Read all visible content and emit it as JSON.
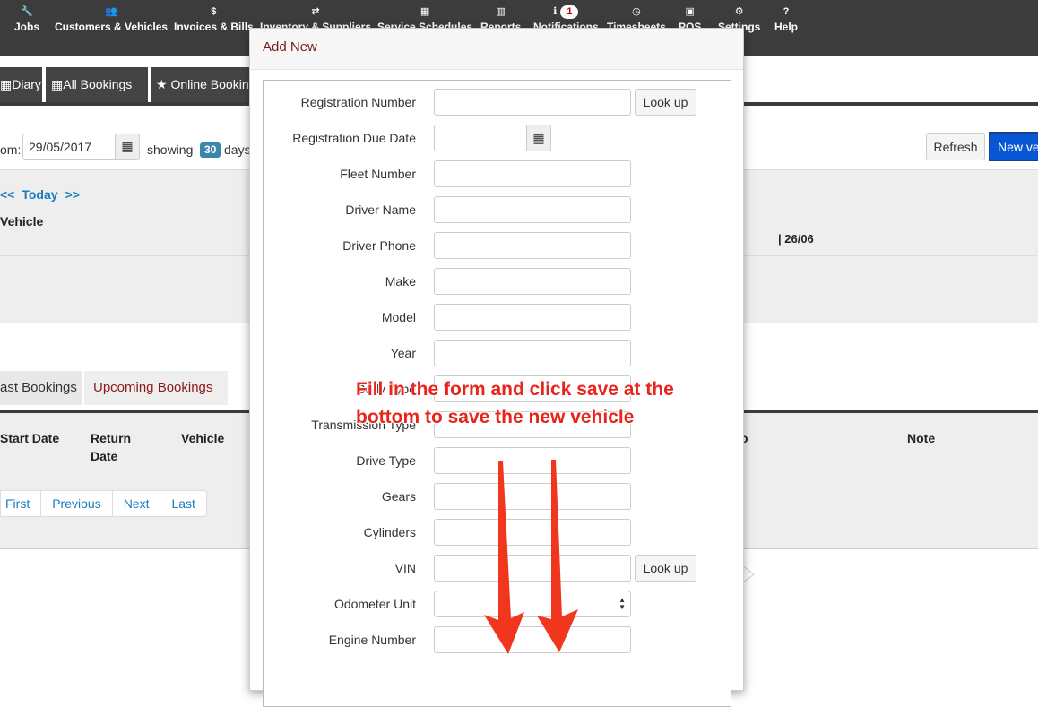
{
  "nav": {
    "items": [
      {
        "label": "Jobs",
        "icon": "wrench-icon",
        "glyph": "🔧"
      },
      {
        "label": "Customers & Vehicles",
        "icon": "users-icon",
        "glyph": "👥"
      },
      {
        "label": "Invoices & Bills",
        "icon": "dollar-icon",
        "glyph": "$"
      },
      {
        "label": "Inventory & Suppliers",
        "icon": "retweet-icon",
        "glyph": "⇄"
      },
      {
        "label": "Service Schedules",
        "icon": "calendar-icon",
        "glyph": "▦"
      },
      {
        "label": "Reports",
        "icon": "bar-chart-icon",
        "glyph": "▥"
      },
      {
        "label": "Notifications",
        "icon": "info-icon",
        "glyph": "ℹ",
        "badge": "1"
      },
      {
        "label": "Timesheets",
        "icon": "clock-icon",
        "glyph": "◷"
      },
      {
        "label": "POS",
        "icon": "money-icon",
        "glyph": "▣"
      },
      {
        "label": "Settings",
        "icon": "cogs-icon",
        "glyph": "⚙"
      },
      {
        "label": "Help",
        "icon": "question-icon",
        "glyph": "?"
      }
    ]
  },
  "subtabs": [
    {
      "label": "Diary",
      "icon": "calendar-icon",
      "glyph": "▦"
    },
    {
      "label": "All Bookings",
      "icon": "calendar-icon",
      "glyph": "▦"
    },
    {
      "label": "Online Bookings",
      "icon": "star-icon",
      "glyph": "★"
    }
  ],
  "filter": {
    "from_label": "om:",
    "date_value": "29/05/2017",
    "showing": "showing",
    "days_count": "30",
    "days_text": "days",
    "refresh": "Refresh",
    "new_vehicle": "New ve"
  },
  "diary": {
    "prev": "<<",
    "today": "Today",
    "next": ">>",
    "vehicle_header": "Vehicle",
    "date_column": "| 26/06"
  },
  "bookings": {
    "tabs": [
      "ast Bookings",
      "Upcoming Bookings"
    ],
    "columns": [
      "Start Date",
      "Return Date",
      "Vehicle",
      "o",
      "Note"
    ],
    "pager": [
      "First",
      "Previous",
      "Next",
      "Last"
    ]
  },
  "modal": {
    "title": "Add New",
    "lookup_label": "Look up",
    "fields": [
      {
        "label": "Registration Number",
        "type": "text",
        "value": ""
      },
      {
        "label": "Registration Due Date",
        "type": "date",
        "value": ""
      },
      {
        "label": "Fleet Number",
        "type": "text",
        "value": ""
      },
      {
        "label": "Driver Name",
        "type": "text",
        "value": ""
      },
      {
        "label": "Driver Phone",
        "type": "text",
        "value": ""
      },
      {
        "label": "Make",
        "type": "text",
        "value": ""
      },
      {
        "label": "Model",
        "type": "text",
        "value": ""
      },
      {
        "label": "Year",
        "type": "text",
        "value": ""
      },
      {
        "label": "Body Type",
        "type": "text",
        "value": ""
      },
      {
        "label": "Transmission Type",
        "type": "text",
        "value": ""
      },
      {
        "label": "Drive Type",
        "type": "text",
        "value": ""
      },
      {
        "label": "Gears",
        "type": "text",
        "value": ""
      },
      {
        "label": "Cylinders",
        "type": "text",
        "value": ""
      },
      {
        "label": "VIN",
        "type": "text",
        "value": ""
      },
      {
        "label": "Odometer Unit",
        "type": "select",
        "value": ""
      },
      {
        "label": "Engine Number",
        "type": "text",
        "value": ""
      }
    ]
  },
  "annotation": {
    "line1": "Fill in the form and click save at the",
    "line2": "bottom to save the new vehicle",
    "color": "#e8241b"
  }
}
